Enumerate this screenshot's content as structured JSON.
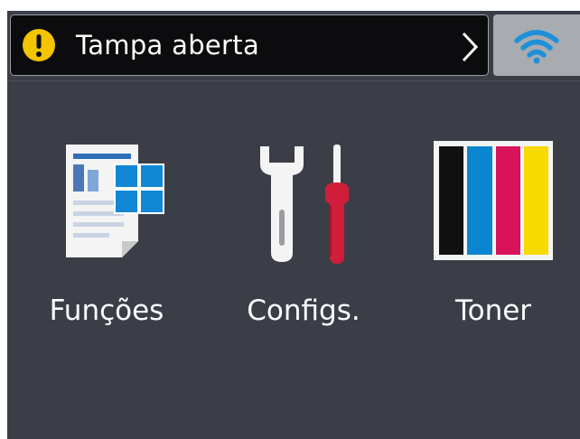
{
  "status": {
    "message": "Tampa aberta",
    "icon": "warning-icon",
    "accent": "#f3c400"
  },
  "wifi": {
    "icon": "wifi-icon",
    "color": "#1e90d8"
  },
  "tiles": [
    {
      "label": "Funções",
      "icon": "document-functions-icon"
    },
    {
      "label": "Configs.",
      "icon": "tools-icon"
    },
    {
      "label": "Toner",
      "icon": "toner-cartridges-icon"
    }
  ],
  "toner_colors": [
    "#111111",
    "#0a86d0",
    "#d8135a",
    "#f7da00"
  ]
}
